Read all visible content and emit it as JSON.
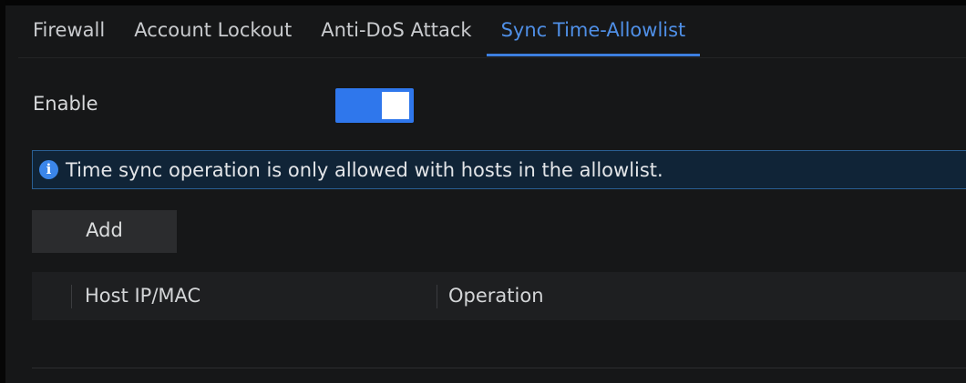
{
  "tabs": [
    {
      "label": "Firewall",
      "active": false
    },
    {
      "label": "Account Lockout",
      "active": false
    },
    {
      "label": "Anti-DoS Attack",
      "active": false
    },
    {
      "label": "Sync Time-Allowlist",
      "active": true
    }
  ],
  "enable": {
    "label": "Enable",
    "state": true,
    "toggle_color": "#2f77ec"
  },
  "info": {
    "icon": "info-icon",
    "icon_glyph": "i",
    "text": "Time sync operation is only allowed with hosts in the allowlist."
  },
  "add_button": {
    "label": "Add"
  },
  "table": {
    "columns": [
      "Host IP/MAC",
      "Operation"
    ],
    "rows": []
  },
  "colors": {
    "accent": "#3d7fe0",
    "active_tab_text": "#4f8fe6",
    "background": "#161718"
  }
}
